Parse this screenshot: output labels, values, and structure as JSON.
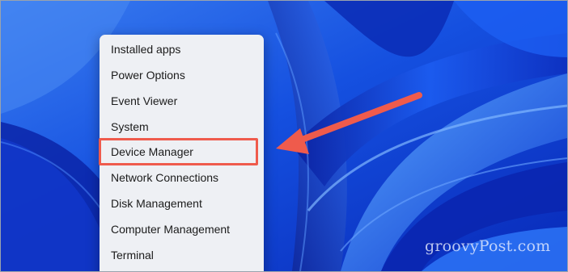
{
  "context_menu": {
    "items": [
      {
        "label": "Installed apps"
      },
      {
        "label": "Power Options"
      },
      {
        "label": "Event Viewer"
      },
      {
        "label": "System"
      },
      {
        "label": "Device Manager"
      },
      {
        "label": "Network Connections"
      },
      {
        "label": "Disk Management"
      },
      {
        "label": "Computer Management"
      },
      {
        "label": "Terminal"
      }
    ],
    "highlighted_item": "Device Manager"
  },
  "annotation": {
    "arrow_color": "#ef5b4c",
    "highlight_color": "#ef5b4c"
  },
  "watermark": {
    "text": "groovyPost.com"
  },
  "wallpaper": {
    "style": "Windows 11 blue bloom",
    "base_color": "#0a2fd0"
  }
}
